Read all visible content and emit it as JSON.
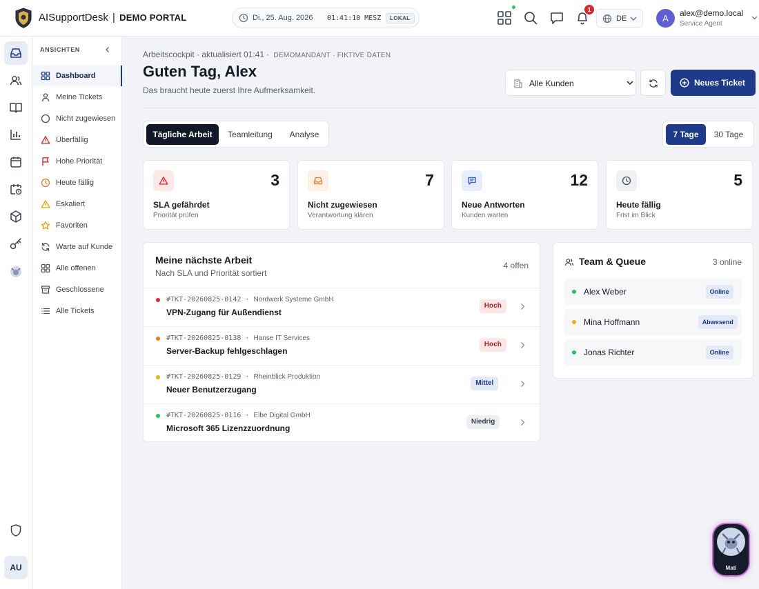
{
  "header": {
    "brand": "AISupportDesk",
    "portal": "DEMO PORTAL",
    "date": "Di., 25. Aug. 2026",
    "time": "01:41:10 MESZ",
    "time_tag": "LOKAL",
    "notification_count": "1",
    "language": "DE",
    "user_initial": "A",
    "user_email": "alex@demo.local",
    "user_role": "Service Agent"
  },
  "rail": {
    "user_initials": "AU"
  },
  "nav": {
    "heading": "ANSICHTEN",
    "items": [
      {
        "label": "Dashboard",
        "icon": "grid-icon"
      },
      {
        "label": "Meine Tickets",
        "icon": "user-icon"
      },
      {
        "label": "Nicht zugewiesen",
        "icon": "circle-icon"
      },
      {
        "label": "Überfällig",
        "icon": "warning-icon"
      },
      {
        "label": "Hohe Priorität",
        "icon": "flag-icon"
      },
      {
        "label": "Heute fällig",
        "icon": "clock-icon"
      },
      {
        "label": "Eskaliert",
        "icon": "warning-icon"
      },
      {
        "label": "Favoriten",
        "icon": "star-icon"
      },
      {
        "label": "Warte auf Kunde",
        "icon": "refresh-icon"
      },
      {
        "label": "Alle offenen",
        "icon": "grid-icon"
      },
      {
        "label": "Geschlossene",
        "icon": "archive-icon"
      },
      {
        "label": "Alle Tickets",
        "icon": "list-icon"
      }
    ]
  },
  "main": {
    "breadcrumb": "Arbeitscockpit · aktualisiert 01:41 ·",
    "breadcrumb_meta": "DEMOMANDANT · FIKTIVE DATEN",
    "greeting": "Guten Tag, Alex",
    "subtitle": "Das braucht heute zuerst Ihre Aufmerksamkeit.",
    "customer_select": "Alle Kunden",
    "new_ticket": "Neues Ticket",
    "tabs": [
      "Tägliche Arbeit",
      "Teamleitung",
      "Analyse"
    ],
    "ranges": [
      "7 Tage",
      "30 Tage"
    ]
  },
  "kpis": [
    {
      "value": "3",
      "title": "SLA gefährdet",
      "sub": "Priorität prüfen",
      "icon": "warning-icon",
      "color": "#e0242d",
      "bg": "#fde8e8"
    },
    {
      "value": "7",
      "title": "Nicht zugewiesen",
      "sub": "Verantwortung klären",
      "icon": "inbox-icon",
      "color": "#e8792a",
      "bg": "#fdf0e4"
    },
    {
      "value": "12",
      "title": "Neue Antworten",
      "sub": "Kunden warten",
      "icon": "message-icon",
      "color": "#2e5bd6",
      "bg": "#e6edfb"
    },
    {
      "value": "5",
      "title": "Heute fällig",
      "sub": "Frist im Blick",
      "icon": "clock-icon",
      "color": "#4a505c",
      "bg": "#eef0f3"
    }
  ],
  "work": {
    "title": "Meine nächste Arbeit",
    "subtitle": "Nach SLA und Priorität sortiert",
    "count": "4 offen",
    "tickets": [
      {
        "id": "#TKT-20260825-0142",
        "customer": "Nordwerk Systeme GmbH",
        "title": "VPN-Zugang für Außendienst",
        "priority": "Hoch",
        "dot": "#e0242d",
        "pcolor": "#b4232b",
        "pbg": "#fde6e6"
      },
      {
        "id": "#TKT-20260825-0138",
        "customer": "Hanse IT Services",
        "title": "Server-Backup fehlgeschlagen",
        "priority": "Hoch",
        "dot": "#f07a1a",
        "pcolor": "#b4232b",
        "pbg": "#fde6e6"
      },
      {
        "id": "#TKT-20260825-0129",
        "customer": "Rheinblick Produktion",
        "title": "Neuer Benutzerzugang",
        "priority": "Mittel",
        "dot": "#eab308",
        "pcolor": "#1e3a8a",
        "pbg": "#e3e9f7"
      },
      {
        "id": "#TKT-20260825-0116",
        "customer": "Elbe Digital GmbH",
        "title": "Microsoft 365 Lizenzzuordnung",
        "priority": "Niedrig",
        "dot": "#22c55e",
        "pcolor": "#3b414d",
        "pbg": "#eef0f3"
      }
    ]
  },
  "team": {
    "title": "Team & Queue",
    "count": "3 online",
    "members": [
      {
        "name": "Alex Weber",
        "status": "Online",
        "dot": "#22c55e"
      },
      {
        "name": "Mina Hoffmann",
        "status": "Abwesend",
        "dot": "#eab308"
      },
      {
        "name": "Jonas Richter",
        "status": "Online",
        "dot": "#22c55e"
      }
    ]
  },
  "assistant": {
    "name": "Mati"
  }
}
